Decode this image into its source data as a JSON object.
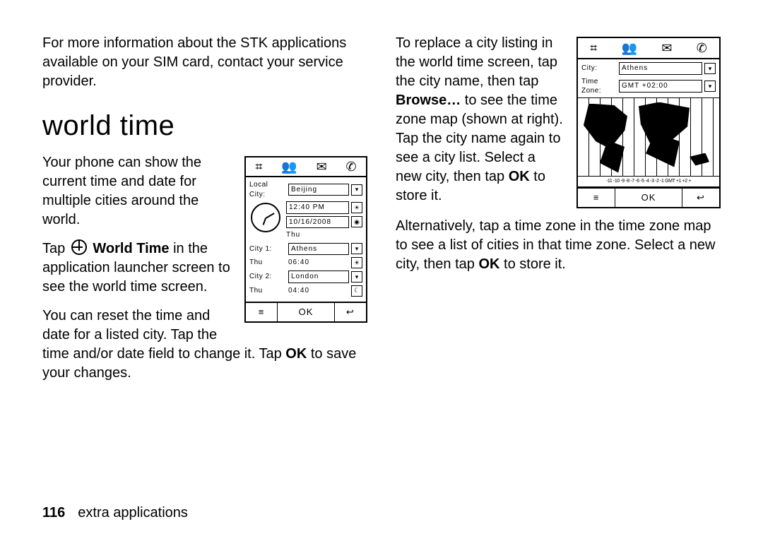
{
  "left": {
    "intro_para": "For more information about the STK applications available on your SIM card, contact your service provider.",
    "heading": "world time",
    "para1": "Your phone can show the current time and date for multiple cities around the world.",
    "para2_pre": "Tap ",
    "para2_bold": "World Time",
    "para2_post": " in the application launcher screen to see the world time screen.",
    "para3_pre": "You can reset the time and date for a listed city. Tap the time and/or date field to change it. Tap ",
    "para3_bold": "OK",
    "para3_post": " to save your changes."
  },
  "right": {
    "para1_pre": "To replace a city listing in the world time screen, tap the city name, then tap ",
    "para1_bold1": "Browse…",
    "para1_mid": " to see the time zone map (shown at right). Tap the city name again to see a city list. Select a new city, then tap ",
    "para1_bold2": "OK",
    "para1_post": " to store it.",
    "para2_pre": "Alternatively, tap a time zone in the time zone map to see a list of cities in that time zone. Select a new city, then tap ",
    "para2_bold": "OK",
    "para2_post": " to store it."
  },
  "screen1": {
    "local_city_label": "Local City:",
    "local_city": "Beijing",
    "time": "12:40 PM",
    "date": "10/16/2008",
    "day": "Thu",
    "city1_label": "City 1:",
    "city1": "Athens",
    "city1_day": "Thu",
    "city1_time": "06:40",
    "city2_label": "City 2:",
    "city2": "London",
    "city2_day": "Thu",
    "city2_time": "04:40",
    "ok": "OK"
  },
  "screen2": {
    "city_label": "City:",
    "city": "Athens",
    "tz_label": "Time Zone:",
    "tz": "GMT +02:00",
    "tz_numbers": "-11 -10 -9 -8 -7 -6 -5 -4 -3 -2 -1 GMT +1 +2 +",
    "ok": "OK"
  },
  "footer": {
    "page": "116",
    "section": "extra applications"
  }
}
